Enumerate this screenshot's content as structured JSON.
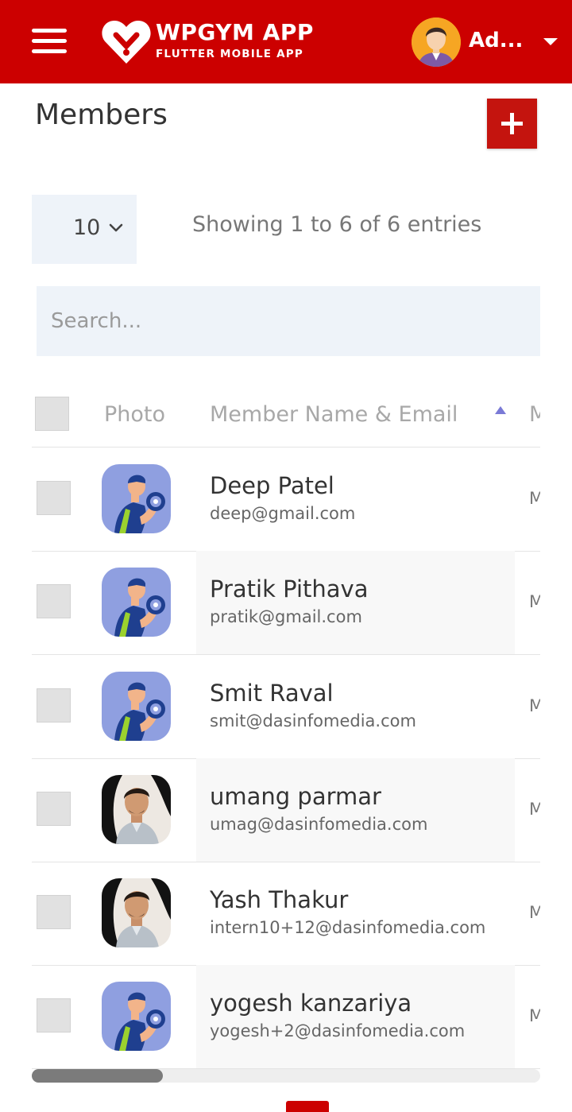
{
  "header": {
    "app_name": "WPGYM APP",
    "app_subtitle": "FLUTTER MOBILE APP",
    "user_name": "Ad..."
  },
  "page": {
    "title": "Members"
  },
  "controls": {
    "page_length": "10",
    "entries_info": "Showing 1 to 6 of 6 entries",
    "search_placeholder": "Search..."
  },
  "table": {
    "columns": [
      "Photo",
      "Member Name & Email",
      "M"
    ],
    "sorted_column": "Member Name & Email",
    "sort_direction": "ascending",
    "rows": [
      {
        "name": "Deep Patel",
        "email": "deep@gmail.com",
        "next_col": "M",
        "photo": "default-gym-avatar"
      },
      {
        "name": "Pratik Pithava",
        "email": "pratik@gmail.com",
        "next_col": "M",
        "photo": "default-gym-avatar"
      },
      {
        "name": "Smit Raval",
        "email": "smit@dasinfomedia.com",
        "next_col": "M",
        "photo": "default-gym-avatar"
      },
      {
        "name": "umang parmar",
        "email": "umag@dasinfomedia.com",
        "next_col": "M",
        "photo": "member-photo"
      },
      {
        "name": "Yash Thakur",
        "email": "intern10+12@dasinfomedia.com",
        "next_col": "M",
        "photo": "member-photo"
      },
      {
        "name": "yogesh kanzariya",
        "email": "yogesh+2@dasinfomedia.com",
        "next_col": "M",
        "photo": "default-gym-avatar"
      }
    ]
  },
  "colors": {
    "brand_red": "#cc0000",
    "add_button": "#c4140e",
    "input_bg": "#eef3f9",
    "sort_icon": "#7a7ad6"
  }
}
